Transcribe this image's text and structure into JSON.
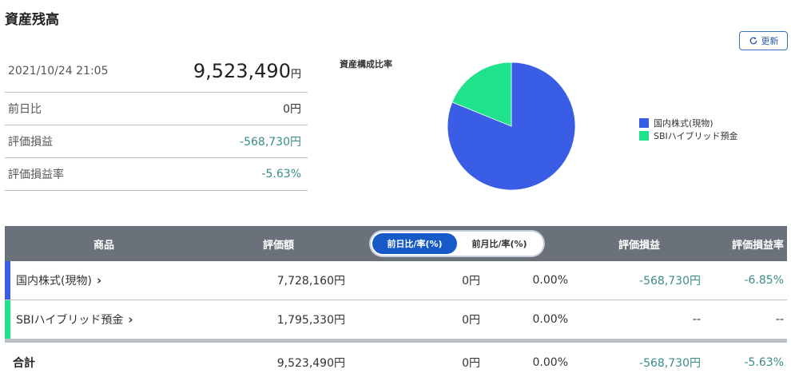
{
  "header": {
    "title": "資産残高",
    "refresh_label": "更新"
  },
  "summary": {
    "datetime": "2021/10/24 21:05",
    "total_value": "9,523,490",
    "total_unit": "円",
    "rows": [
      {
        "label": "前日比",
        "value": "0円"
      },
      {
        "label": "評価損益",
        "value": "-568,730円"
      },
      {
        "label": "評価損益率",
        "value": "-5.63%"
      }
    ]
  },
  "composition": {
    "label": "資産構成比率",
    "legend": [
      {
        "name": "国内株式(現物)",
        "color": "#3a5de6"
      },
      {
        "name": "SBIハイブリッド預金",
        "color": "#1ee38a"
      }
    ]
  },
  "chart_data": {
    "type": "pie",
    "title": "資産構成比率",
    "labels": [
      "国内株式(現物)",
      "SBIハイブリッド預金"
    ],
    "values": [
      7728160,
      1795330
    ],
    "colors": [
      "#3a5de6",
      "#1ee38a"
    ],
    "legend_position": "right"
  },
  "table": {
    "headers": {
      "name": "商品",
      "value": "評価額",
      "pl": "評価損益",
      "plr": "評価損益率"
    },
    "toggle": {
      "day": "前日比/率(%)",
      "month": "前月比/率(%)"
    },
    "rows": [
      {
        "name": "国内株式(現物)",
        "value": "7,728,160円",
        "day_amount": "0円",
        "day_rate": "0.00%",
        "pl": "-568,730円",
        "plr": "-6.85%",
        "accent": "#3a5de6"
      },
      {
        "name": "SBIハイブリッド預金",
        "value": "1,795,330円",
        "day_amount": "0円",
        "day_rate": "0.00%",
        "pl": "--",
        "plr": "--",
        "accent": "#1ee38a"
      }
    ],
    "total": {
      "label": "合計",
      "value": "9,523,490円",
      "day_amount": "0円",
      "day_rate": "0.00%",
      "pl": "-568,730円",
      "plr": "-5.63%"
    }
  }
}
